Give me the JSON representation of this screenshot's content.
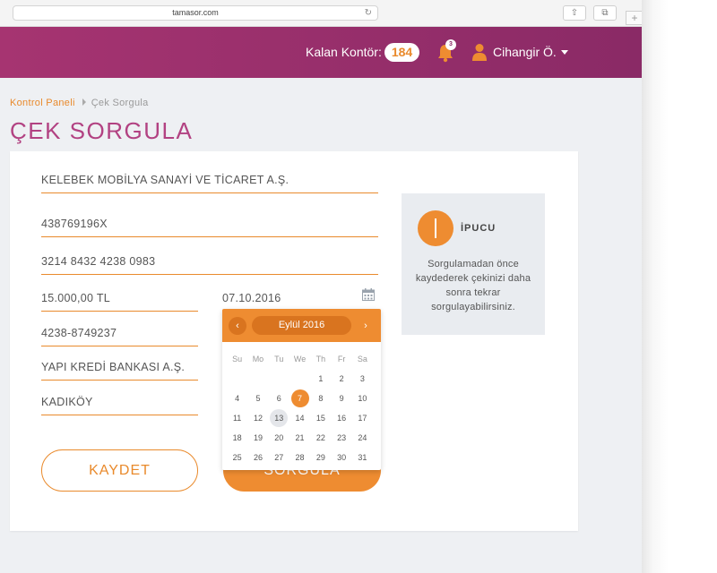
{
  "browser": {
    "url": "tamasor.com"
  },
  "topbar": {
    "credit_label": "Kalan Kontör:",
    "credit_value": "184",
    "notification_count": "3",
    "user_name": "Cihangir Ö."
  },
  "breadcrumb": {
    "home": "Kontrol Paneli",
    "current": "Çek Sorgula"
  },
  "page_title": "ÇEK SORGULA",
  "form": {
    "company": "KELEBEK MOBİLYA SANAYİ VE TİCARET A.Ş.",
    "tax_no": "438769196X",
    "cheque_no": "3214 8432 4238 0983",
    "amount": "15.000,00 TL",
    "date": "07.10.2016",
    "account_no": "4238-8749237",
    "bank": "YAPI KREDİ BANKASI A.Ş.",
    "branch": "KADIKÖY",
    "save_label": "KAYDET",
    "query_label": "SORGULA"
  },
  "tip": {
    "title": "İPUCU",
    "text": "Sorgulamadan önce kaydederek çekinizi daha sonra tekrar sorgulayabilirsiniz."
  },
  "datepicker": {
    "month_label": "Eylül 2016",
    "weekdays": [
      "Su",
      "Mo",
      "Tu",
      "We",
      "Th",
      "Fr",
      "Sa"
    ],
    "weeks": [
      [
        "",
        "",
        "",
        "",
        "1",
        "2",
        "3"
      ],
      [
        "4",
        "5",
        "6",
        "7",
        "8",
        "9",
        "10"
      ],
      [
        "11",
        "12",
        "13",
        "14",
        "15",
        "16",
        "17"
      ],
      [
        "18",
        "19",
        "20",
        "21",
        "22",
        "23",
        "24"
      ],
      [
        "25",
        "26",
        "27",
        "28",
        "29",
        "30",
        "31"
      ]
    ],
    "selected": "7",
    "today": "13"
  },
  "colors": {
    "accent": "#ee8c31",
    "brand": "#8a2a66"
  }
}
